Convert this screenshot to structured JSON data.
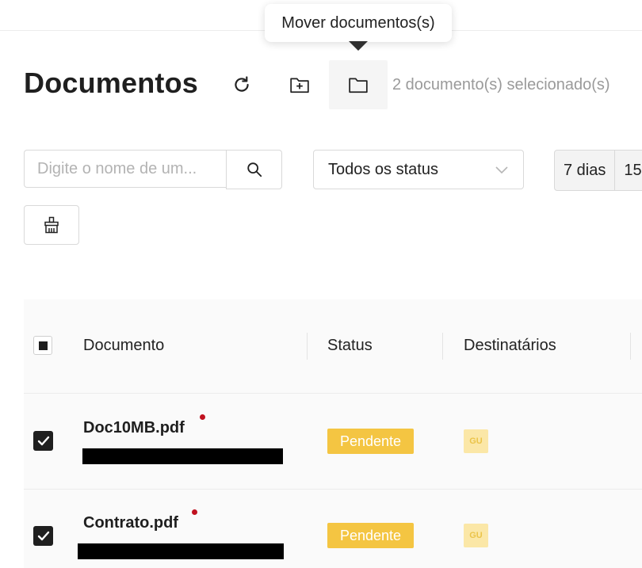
{
  "tooltip": {
    "text": "Mover documentos(s)"
  },
  "header": {
    "title": "Documentos",
    "selected_count": "2 documento(s) selecionado(s)",
    "tools": [
      {
        "icon": "refresh-icon"
      },
      {
        "icon": "new-folder-icon"
      },
      {
        "icon": "folder-icon"
      }
    ]
  },
  "filters": {
    "search_placeholder": "Digite o nome de um...",
    "search_icon": "search-icon",
    "status_selected": "Todos os status",
    "period_options": [
      "7 dias",
      "15"
    ],
    "clean_icon": "broom-icon"
  },
  "table": {
    "columns": [
      "Documento",
      "Status",
      "Destinatários"
    ],
    "rows": [
      {
        "name": "Doc10MB.pdf",
        "status": "Pendente",
        "recipient": "GU",
        "checked": true,
        "unread": true
      },
      {
        "name": "Contrato.pdf",
        "status": "Pendente",
        "recipient": "GU",
        "checked": true,
        "unread": true
      }
    ]
  },
  "colors": {
    "status_pending": "#f4c542",
    "avatar_bg": "#fbe7a7",
    "unread_dot": "#c0111f"
  }
}
